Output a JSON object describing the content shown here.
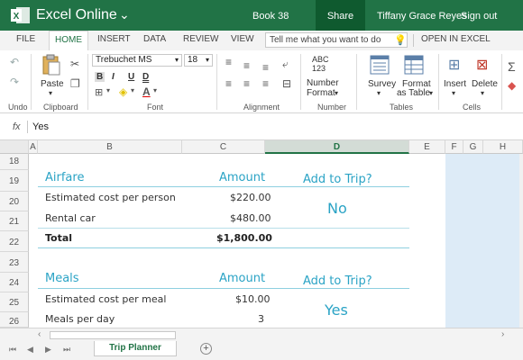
{
  "titlebar": {
    "app_name": "Excel Online",
    "book": "Book 38",
    "share": "Share",
    "user": "Tiffany Grace Reyes",
    "signout": "Sign out"
  },
  "tabs": [
    "FILE",
    "HOME",
    "INSERT",
    "DATA",
    "REVIEW",
    "VIEW"
  ],
  "active_tab": "HOME",
  "tell_me": "Tell me what you want to do",
  "open_in_excel": "OPEN IN EXCEL",
  "ribbon": {
    "undo_label": "Undo",
    "clipboard": {
      "paste": "Paste",
      "group": "Clipboard"
    },
    "font": {
      "name": "Trebuchet MS",
      "size": "18",
      "bold": "B",
      "italic": "I",
      "underline": "U",
      "double_underline": "D",
      "group": "Font"
    },
    "alignment_group": "Alignment",
    "number": {
      "abc": "ABC",
      "num": "123",
      "label1": "Number",
      "label2": "Format",
      "group": "Number"
    },
    "tables": {
      "survey": "Survey",
      "format1": "Format",
      "format2": "as Table",
      "group": "Tables"
    },
    "cells": {
      "insert": "Insert",
      "delete": "Delete",
      "group": "Cells"
    }
  },
  "formula_bar": {
    "fx": "fx",
    "value": "Yes"
  },
  "columns": [
    "A",
    "B",
    "C",
    "D",
    "E",
    "F",
    "G",
    "H"
  ],
  "selected_column": "D",
  "rows": [
    "18",
    "19",
    "20",
    "21",
    "22",
    "23",
    "24",
    "25",
    "26"
  ],
  "sheet": {
    "airfare": {
      "title": "Airfare",
      "amount_header": "Amount",
      "add_header": "Add to Trip?",
      "items": [
        {
          "label": "Estimated cost per person",
          "amount": "$220.00"
        },
        {
          "label": "Rental car",
          "amount": "$480.00"
        }
      ],
      "total_label": "Total",
      "total_amount": "$1,800.00",
      "answer": "No"
    },
    "meals": {
      "title": "Meals",
      "amount_header": "Amount",
      "add_header": "Add to Trip?",
      "items": [
        {
          "label": "Estimated cost per meal",
          "amount": "$10.00"
        },
        {
          "label": "Meals per day",
          "amount": "3"
        }
      ],
      "answer": "Yes"
    }
  },
  "sheet_tab": "Trip Planner",
  "colors": {
    "brand": "#217346",
    "teal": "#2aa3c5",
    "selection_fill": "#ddebf7"
  }
}
